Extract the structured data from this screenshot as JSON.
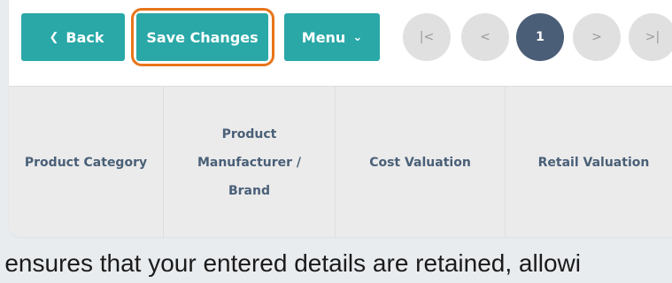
{
  "toolbar": {
    "back_label": "Back",
    "back_icon": "chevron-left-icon",
    "save_label": "Save Changes",
    "menu_label": "Menu",
    "menu_icon": "chevron-down-icon"
  },
  "pagination": {
    "first": "|<",
    "prev": "<",
    "current_page": "1",
    "next": ">",
    "last": ">|"
  },
  "table": {
    "columns": [
      "Product Category",
      "Product Manufacturer / Brand",
      "Cost Valuation",
      "Retail Valuation"
    ]
  },
  "footer_text": "e ensures that your entered details are retained, allowi",
  "colors": {
    "button": "#2aa8a8",
    "highlight": "#e8751a",
    "page_current": "#4b5e77",
    "header_text": "#4a6078"
  }
}
